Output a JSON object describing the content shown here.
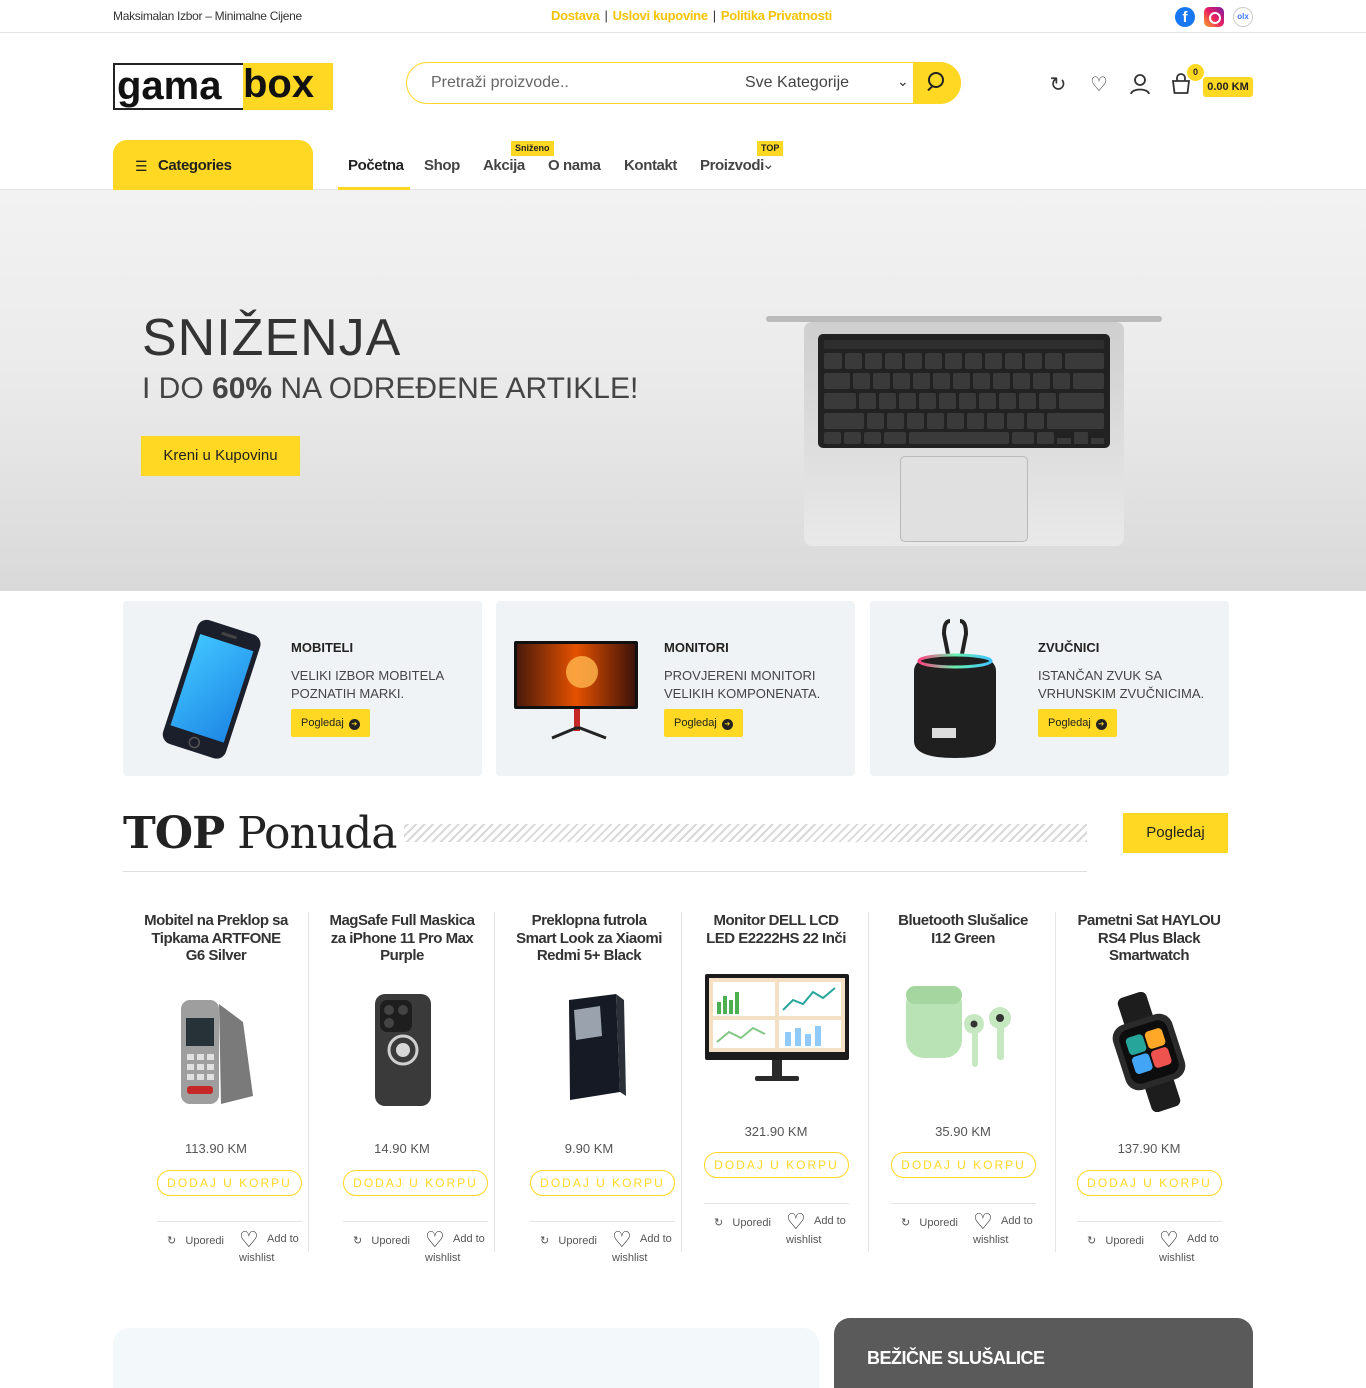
{
  "topbar": {
    "tagline": "Maksimalan Izbor – Minimalne Cijene",
    "links": [
      "Dostava",
      "Uslovi kupovine",
      "Politika Privatnosti"
    ],
    "separator": "|",
    "social": [
      {
        "icon": "facebook-icon",
        "text": "f"
      },
      {
        "icon": "instagram-icon",
        "text": ""
      },
      {
        "icon": "olx-icon",
        "text": "olx"
      }
    ]
  },
  "header": {
    "logo_left": "gama",
    "logo_right": "box",
    "search_placeholder": "Pretraži proizvode..",
    "category_select": "Sve Kategorije",
    "cart_count": "0",
    "cart_total": "0.00 KM",
    "icons": [
      "compare-icon",
      "heart-icon",
      "user-icon",
      "cart-icon"
    ]
  },
  "nav": {
    "categories_label": "Categories",
    "items": [
      "Početna",
      "Shop",
      "Akcija",
      "O nama",
      "Kontakt",
      "Proizvodi"
    ],
    "badge_akcija": "Sniženo",
    "badge_proizvodi": "TOP"
  },
  "hero": {
    "title": "SNIŽENJA",
    "subtitle_prefix": "I DO ",
    "subtitle_bold": "60%",
    "subtitle_suffix": " NA ODREĐENE ARTIKLE!",
    "cta": "Kreni u Kupovinu"
  },
  "categories": [
    {
      "title": "MOBITELI",
      "desc": "VELIKI IZBOR MOBITELA POZNATIH MARKI.",
      "button": "Pogledaj"
    },
    {
      "title": "MONITORI",
      "desc": "PROVJERENI MONITORI VELIKIH KOMPONENATA.",
      "button": "Pogledaj"
    },
    {
      "title": "ZVUČNICI",
      "desc": "ISTANČAN ZVUK SA VRHUNSKIM ZVUČNICIMA.",
      "button": "Pogledaj"
    }
  ],
  "top_offer": {
    "title_bold": "TOP",
    "title_rest": " Ponuda",
    "button": "Pogledaj"
  },
  "products": [
    {
      "name": "Mobitel na Preklop sa Tipkama ARTFONE G6 Silver",
      "price": "113.90 KM",
      "add": "DODAJ U KORPU",
      "compare": "Uporedi",
      "wishlist": "Add to wishlist"
    },
    {
      "name": "MagSafe Full Maskica za iPhone 11 Pro Max Purple",
      "price": "14.90 KM",
      "add": "DODAJ U KORPU",
      "compare": "Uporedi",
      "wishlist": "Add to wishlist"
    },
    {
      "name": "Preklopna futrola Smart Look za Xiaomi Redmi 5+ Black",
      "price": "9.90 KM",
      "add": "DODAJ U KORPU",
      "compare": "Uporedi",
      "wishlist": "Add to wishlist"
    },
    {
      "name": "Monitor DELL LCD LED E2222HS 22 Inči",
      "price": "321.90 KM",
      "add": "DODAJ U KORPU",
      "compare": "Uporedi",
      "wishlist": "Add to wishlist"
    },
    {
      "name": "Bluetooth Slušalice I12 Green",
      "price": "35.90 KM",
      "add": "DODAJ U KORPU",
      "compare": "Uporedi",
      "wishlist": "Add to wishlist"
    },
    {
      "name": "Pametni Sat HAYLOU RS4 Plus Black Smartwatch",
      "price": "137.90 KM",
      "add": "DODAJ U KORPU",
      "compare": "Uporedi",
      "wishlist": "Add to wishlist"
    }
  ],
  "bottom": {
    "right_title": "BEŽIČNE SLUŠALICE"
  },
  "colors": {
    "accent": "#ffd823",
    "link": "#f5c400"
  }
}
